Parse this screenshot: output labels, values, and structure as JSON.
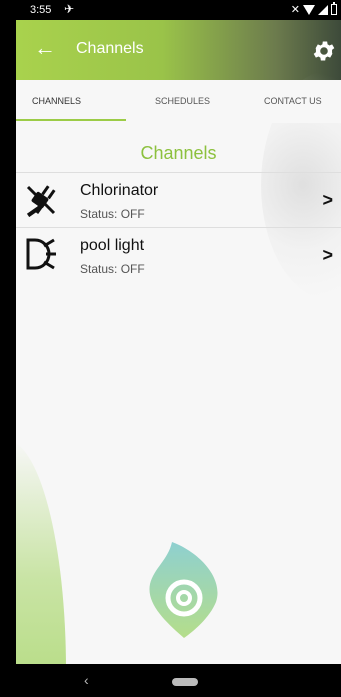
{
  "status_bar": {
    "time": "3:55"
  },
  "app_bar": {
    "title": "Channels",
    "accent_color": "#a9d24d"
  },
  "tabs": [
    {
      "label": "CHANNELS",
      "active": true
    },
    {
      "label": "SCHEDULES",
      "active": false
    },
    {
      "label": "CONTACT US",
      "active": false
    }
  ],
  "section": {
    "title": "Channels"
  },
  "channels": [
    {
      "name": "Chlorinator",
      "status": "Status: OFF",
      "icon": "plug-icon"
    },
    {
      "name": "pool light",
      "status": "Status: OFF",
      "icon": "light-icon"
    }
  ],
  "nav": {
    "back": "‹"
  }
}
